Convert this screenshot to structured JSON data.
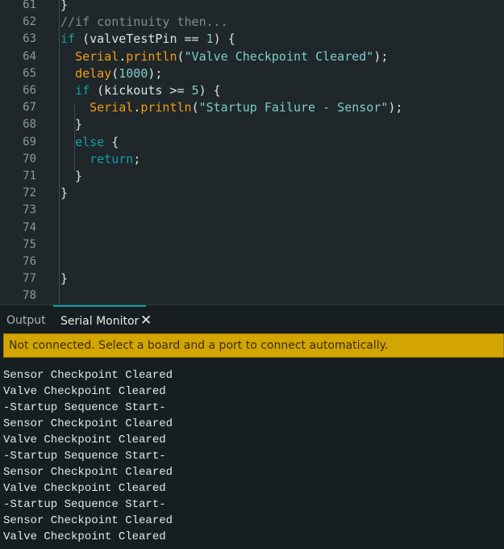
{
  "editor": {
    "lines": [
      {
        "n": "61",
        "tokens": [
          {
            "t": "}",
            "c": ""
          }
        ]
      },
      {
        "n": "62",
        "tokens": [
          {
            "t": "//if continuity then...",
            "c": "cm"
          }
        ]
      },
      {
        "n": "63",
        "tokens": [
          {
            "t": "if",
            "c": "kw"
          },
          {
            "t": " (valveTestPin == ",
            "c": ""
          },
          {
            "t": "1",
            "c": "num"
          },
          {
            "t": ") {",
            "c": ""
          }
        ]
      },
      {
        "n": "64",
        "tokens": [
          {
            "t": "  ",
            "c": ""
          },
          {
            "t": "Serial",
            "c": "fn"
          },
          {
            "t": ".",
            "c": ""
          },
          {
            "t": "println",
            "c": "fn"
          },
          {
            "t": "(",
            "c": ""
          },
          {
            "t": "\"Valve Checkpoint Cleared\"",
            "c": "str"
          },
          {
            "t": ");",
            "c": ""
          }
        ]
      },
      {
        "n": "65",
        "tokens": [
          {
            "t": "  ",
            "c": ""
          },
          {
            "t": "delay",
            "c": "fn"
          },
          {
            "t": "(",
            "c": ""
          },
          {
            "t": "1000",
            "c": "num"
          },
          {
            "t": ");",
            "c": ""
          }
        ]
      },
      {
        "n": "66",
        "tokens": [
          {
            "t": "  ",
            "c": ""
          },
          {
            "t": "if",
            "c": "kw"
          },
          {
            "t": " (kickouts >= ",
            "c": ""
          },
          {
            "t": "5",
            "c": "num"
          },
          {
            "t": ") {",
            "c": ""
          }
        ]
      },
      {
        "n": "67",
        "tokens": [
          {
            "t": "    ",
            "c": ""
          },
          {
            "t": "Serial",
            "c": "fn"
          },
          {
            "t": ".",
            "c": ""
          },
          {
            "t": "println",
            "c": "fn"
          },
          {
            "t": "(",
            "c": ""
          },
          {
            "t": "\"Startup Failure - Sensor\"",
            "c": "str"
          },
          {
            "t": ");",
            "c": ""
          }
        ]
      },
      {
        "n": "68",
        "tokens": [
          {
            "t": "  }",
            "c": ""
          }
        ]
      },
      {
        "n": "69",
        "tokens": [
          {
            "t": "  ",
            "c": ""
          },
          {
            "t": "else",
            "c": "kw"
          },
          {
            "t": " {",
            "c": ""
          }
        ]
      },
      {
        "n": "70",
        "tokens": [
          {
            "t": "    ",
            "c": ""
          },
          {
            "t": "return",
            "c": "kw"
          },
          {
            "t": ";",
            "c": ""
          }
        ]
      },
      {
        "n": "71",
        "tokens": [
          {
            "t": "  }",
            "c": ""
          }
        ]
      },
      {
        "n": "72",
        "tokens": [
          {
            "t": "}",
            "c": ""
          }
        ]
      },
      {
        "n": "73",
        "tokens": []
      },
      {
        "n": "74",
        "tokens": []
      },
      {
        "n": "75",
        "tokens": []
      },
      {
        "n": "76",
        "tokens": []
      },
      {
        "n": "77",
        "tokens": [
          {
            "t": "}",
            "c": ""
          }
        ]
      },
      {
        "n": "78",
        "tokens": []
      }
    ]
  },
  "panel": {
    "tabs": [
      {
        "label": "Output",
        "active": false
      },
      {
        "label": "Serial Monitor",
        "active": true
      }
    ],
    "close_icon": "close-icon",
    "notice": "Not connected. Select a board and a port to connect automatically.",
    "output_lines": [
      "Sensor Checkpoint Cleared",
      "Valve Checkpoint Cleared",
      "-Startup Sequence Start-",
      "Sensor Checkpoint Cleared",
      "Valve Checkpoint Cleared",
      "-Startup Sequence Start-",
      "Sensor Checkpoint Cleared",
      "Valve Checkpoint Cleared",
      "-Startup Sequence Start-",
      "Sensor Checkpoint Cleared",
      "Valve Checkpoint Cleared"
    ]
  },
  "colors": {
    "editor_bg": "#1f272a",
    "keyword": "#0ca1a6",
    "function": "#f39c12",
    "string": "#7fcbcd",
    "comment": "#7f8c8d",
    "notice_bg": "#d3a501"
  }
}
